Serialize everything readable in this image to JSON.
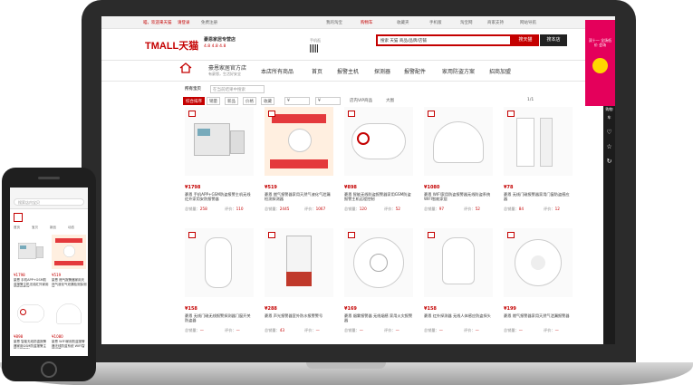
{
  "topbar": {
    "left": [
      "喵，欢迎来天猫",
      "请登录",
      "免费注册"
    ],
    "right": [
      "我的淘宝",
      "购物车",
      "收藏夹",
      "手机版",
      "淘宝网",
      "商家支持",
      "网站导航"
    ]
  },
  "header": {
    "logo": "TMALL天猫",
    "shop_name": "豪恩家居专营店",
    "scores": "4.8  4.8  4.8",
    "search_text": "搜索 天猫 商品/品牌/店铺",
    "search_tmall": "搜天猫",
    "search_shop": "搜本店",
    "mobile_label": "手机逛"
  },
  "nav": {
    "shop_title": "豪恩家居官方店",
    "shop_sub": "有豪恩，生活好安全",
    "items": [
      "本店所有商品",
      "首页",
      "报警主机",
      "探测器",
      "报警配件",
      "家用防盗方案",
      "招商加盟"
    ]
  },
  "filter": {
    "breadcrumb": "所有宝贝",
    "search_placeholder": "在当前结果中搜索",
    "sorts": [
      "综合排序",
      "销量",
      "新品",
      "价格",
      "收藏",
      "¥",
      "¥"
    ],
    "vip": "店内VIP商品",
    "view": "大图",
    "pager": "1/1"
  },
  "products": [
    {
      "price": "¥1798",
      "title": "豪恩 手机APP+GSM防盗报警主机无线红外家用安防报警器",
      "sales_label": "总销量：",
      "sales": "258",
      "reviews_label": "评价：",
      "reviews": "110"
    },
    {
      "price": "¥519",
      "title": "豪恩 燃气报警器家用天然气液化气泄漏检测探测器",
      "sales_label": "总销量：",
      "sales": "2445",
      "reviews_label": "评价：",
      "reviews": "1067"
    },
    {
      "price": "¥898",
      "title": "豪恩 智能无线防盗报警器家用GSM防盗报警主机远程控制",
      "sales_label": "总销量：",
      "sales": "120",
      "reviews_label": "评价：",
      "reviews": "52"
    },
    {
      "price": "¥1080",
      "title": "豪恩 WIFI家用防盗报警器无线防盗系统 WIFI智能家居",
      "sales_label": "总销量：",
      "sales": "97",
      "reviews_label": "评价：",
      "reviews": "52"
    },
    {
      "price": "¥78",
      "title": "豪恩 无线门磁报警器家用门窗防盗感应器",
      "sales_label": "总销量：",
      "sales": "84",
      "reviews_label": "评价：",
      "reviews": "12"
    },
    {
      "price": "¥158",
      "title": "豪恩 无线门磁无线报警探测器门窗开关防盗器",
      "sales_label": "总销量：",
      "sales": "—",
      "reviews_label": "评价：",
      "reviews": "—"
    },
    {
      "price": "¥288",
      "title": "豪恩 声光报警器室外防水报警警号",
      "sales_label": "总销量：",
      "sales": "43",
      "reviews_label": "评价：",
      "reviews": "—"
    },
    {
      "price": "¥169",
      "title": "豪恩 烟雾报警器 无线烟感 家用火灾报警器",
      "sales_label": "总销量：",
      "sales": "—",
      "reviews_label": "评价：",
      "reviews": "—"
    },
    {
      "price": "¥158",
      "title": "豪恩 红外探测器 无线人体感应防盗探头",
      "sales_label": "总销量：",
      "sales": "—",
      "reviews_label": "评价：",
      "reviews": "—"
    },
    {
      "price": "¥199",
      "title": "豪恩 燃气报警器家用天然气泄漏报警器",
      "sales_label": "总销量：",
      "sales": "—",
      "reviews_label": "评价：",
      "reviews": "—"
    }
  ],
  "sidebar": {
    "promo": "双十一 全场低价 会场",
    "icons": [
      "✉",
      "购物车",
      "♡",
      "☆",
      "↻"
    ]
  },
  "phone": {
    "search": "搜索店内宝贝",
    "tabs": [
      "首页",
      "宝贝",
      "新品",
      "动态"
    ]
  }
}
